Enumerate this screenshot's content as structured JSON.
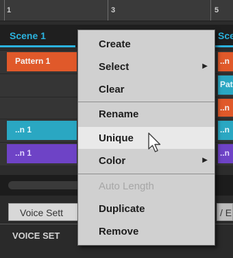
{
  "ruler": {
    "marks": [
      "1",
      "3",
      "5"
    ]
  },
  "scenes": [
    "Scene 1",
    "Sce"
  ],
  "pattern_row": {
    "left": "Pattern 1",
    "right": "..n"
  },
  "row3": {
    "right": "Patt"
  },
  "row4": {
    "right": "..n"
  },
  "row5": {
    "left": "..n 1",
    "right": "..n"
  },
  "row6": {
    "left": "..n 1",
    "right": "..n"
  },
  "bottom": {
    "tab_left": "Voice Sett",
    "tab_right": "/ E",
    "section_label": "VOICE SET"
  },
  "context_menu": {
    "items": [
      {
        "label": "Create"
      },
      {
        "label": "Select",
        "submenu": true
      },
      {
        "label": "Clear"
      },
      {
        "label": "Rename"
      },
      {
        "label": "Unique"
      },
      {
        "label": "Color",
        "submenu": true
      },
      {
        "label": "Auto Length"
      },
      {
        "label": "Duplicate"
      },
      {
        "label": "Remove"
      }
    ],
    "submenu_glyph": "▶",
    "highlighted": "Unique",
    "disabled": [
      "Auto Length"
    ]
  },
  "colors": {
    "accent": "#2bb3df",
    "orange": "#e0592a",
    "purple": "#6e43c6",
    "teal": "#2aa7c2"
  }
}
